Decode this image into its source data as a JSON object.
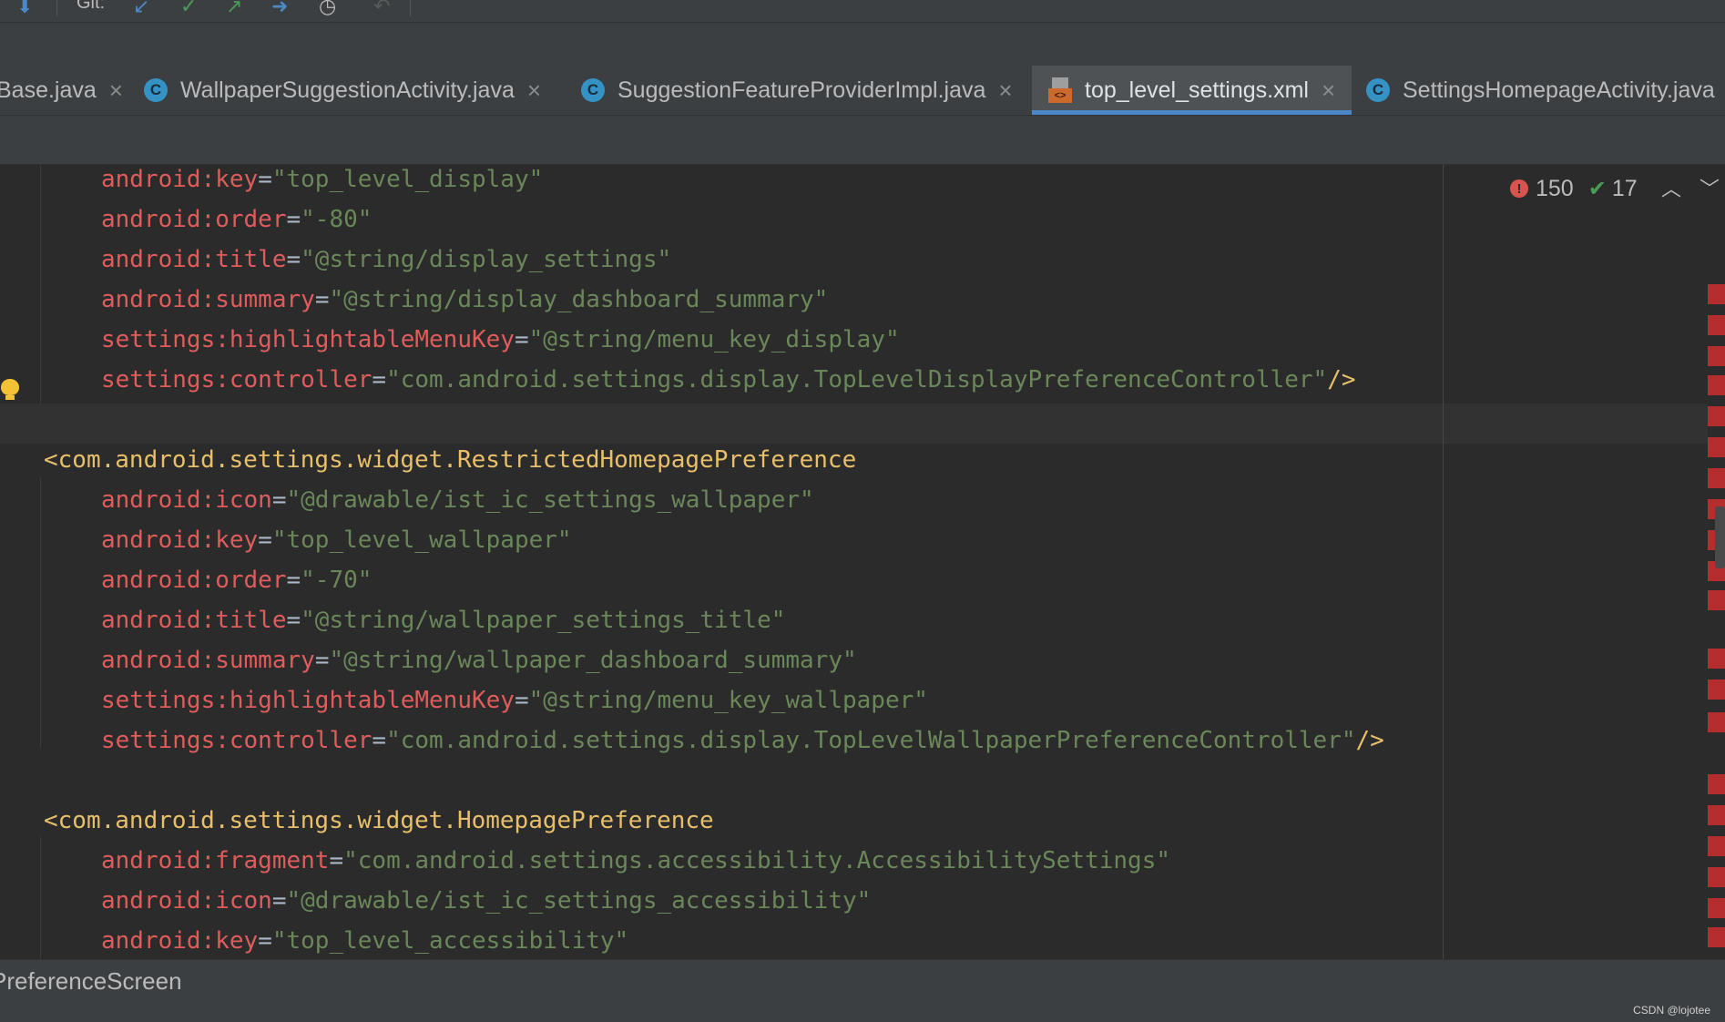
{
  "toolbar": {
    "git_label": "Git:"
  },
  "tabs": [
    {
      "label": "Base.java",
      "icon": "none",
      "active": false
    },
    {
      "label": "WallpaperSuggestionActivity.java",
      "icon": "java-class-icon",
      "active": false
    },
    {
      "label": "SuggestionFeatureProviderImpl.java",
      "icon": "java-class-icon",
      "active": false
    },
    {
      "label": "top_level_settings.xml",
      "icon": "xml-file-icon",
      "active": true
    },
    {
      "label": "SettingsHomepageActivity.java",
      "icon": "java-class-icon",
      "active": false
    }
  ],
  "tab_close_glyph": "×",
  "class_icon_letter": "C",
  "xml_icon_text": "<>",
  "inspections": {
    "errors": "150",
    "warnings": "17"
  },
  "code": {
    "lines": [
      {
        "indent": 1,
        "kind": "attr",
        "name": "android:key",
        "value": "\"top_level_display\"",
        "suffix": ""
      },
      {
        "indent": 1,
        "kind": "attr",
        "name": "android:order",
        "value": "\"-80\"",
        "suffix": ""
      },
      {
        "indent": 1,
        "kind": "attr",
        "name": "android:title",
        "value": "\"@string/display_settings\"",
        "suffix": ""
      },
      {
        "indent": 1,
        "kind": "attr",
        "name": "android:summary",
        "value": "\"@string/display_dashboard_summary\"",
        "suffix": ""
      },
      {
        "indent": 1,
        "kind": "attr",
        "name": "settings:highlightableMenuKey",
        "value": "\"@string/menu_key_display\"",
        "suffix": ""
      },
      {
        "indent": 1,
        "kind": "attr",
        "name": "settings:controller",
        "value": "\"com.android.settings.display.TopLevelDisplayPreferenceController\"",
        "suffix": "/>"
      },
      {
        "indent": 0,
        "kind": "blank"
      },
      {
        "indent": 0,
        "kind": "tag",
        "text": "<com.android.settings.widget.RestrictedHomepagePreference"
      },
      {
        "indent": 1,
        "kind": "attr",
        "name": "android:icon",
        "value": "\"@drawable/ist_ic_settings_wallpaper\"",
        "suffix": ""
      },
      {
        "indent": 1,
        "kind": "attr",
        "name": "android:key",
        "value": "\"top_level_wallpaper\"",
        "suffix": ""
      },
      {
        "indent": 1,
        "kind": "attr",
        "name": "android:order",
        "value": "\"-70\"",
        "suffix": ""
      },
      {
        "indent": 1,
        "kind": "attr",
        "name": "android:title",
        "value": "\"@string/wallpaper_settings_title\"",
        "suffix": ""
      },
      {
        "indent": 1,
        "kind": "attr",
        "name": "android:summary",
        "value": "\"@string/wallpaper_dashboard_summary\"",
        "suffix": ""
      },
      {
        "indent": 1,
        "kind": "attr",
        "name": "settings:highlightableMenuKey",
        "value": "\"@string/menu_key_wallpaper\"",
        "suffix": ""
      },
      {
        "indent": 1,
        "kind": "attr",
        "name": "settings:controller",
        "value": "\"com.android.settings.display.TopLevelWallpaperPreferenceController\"",
        "suffix": "/>"
      },
      {
        "indent": 0,
        "kind": "blank"
      },
      {
        "indent": 0,
        "kind": "tag",
        "text": "<com.android.settings.widget.HomepagePreference"
      },
      {
        "indent": 1,
        "kind": "attr",
        "name": "android:fragment",
        "value": "\"com.android.settings.accessibility.AccessibilitySettings\"",
        "suffix": ""
      },
      {
        "indent": 1,
        "kind": "attr",
        "name": "android:icon",
        "value": "\"@drawable/ist_ic_settings_accessibility\"",
        "suffix": ""
      },
      {
        "indent": 1,
        "kind": "attr",
        "name": "android:key",
        "value": "\"top_level_accessibility\"",
        "suffix": ""
      }
    ]
  },
  "breadcrumb": "PreferenceScreen",
  "watermark": "CSDN @lojotee",
  "colors": {
    "attribute": "#e05c5c",
    "string_value": "#6a8759",
    "tag": "#e8bf6a",
    "error_marker": "#b52d2d",
    "active_tab_underline": "#4a88c7"
  }
}
